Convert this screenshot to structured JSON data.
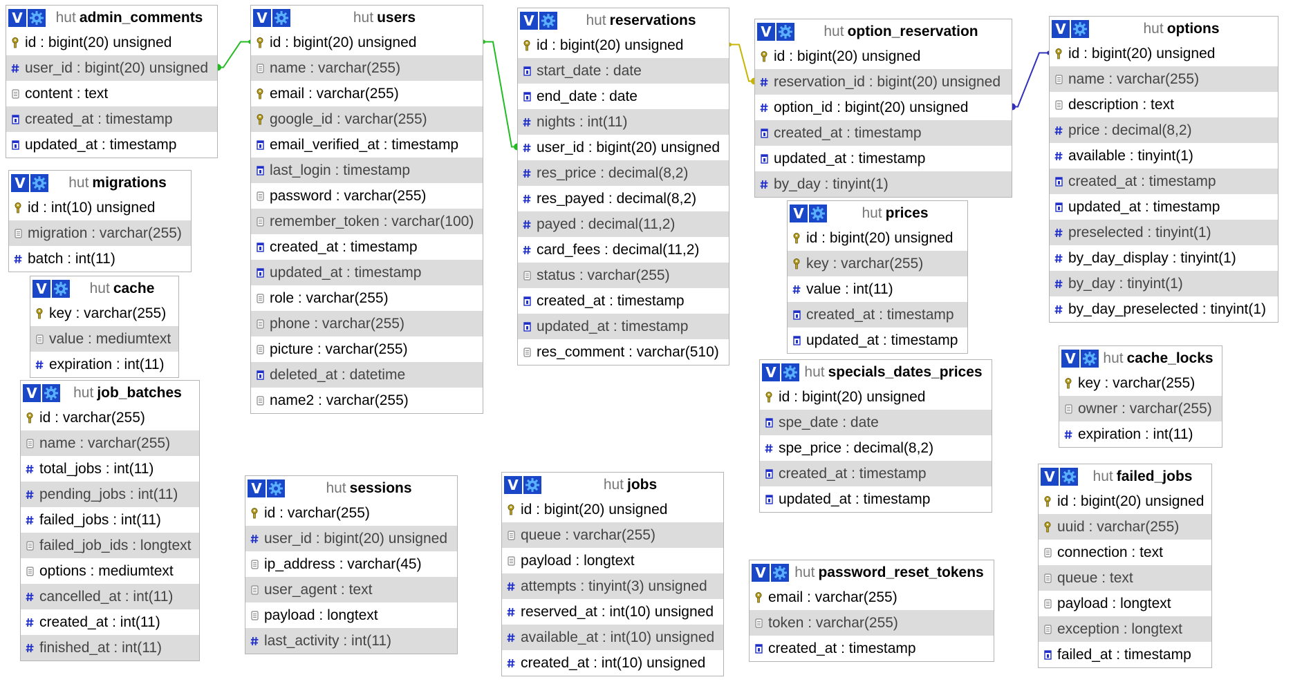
{
  "db_name": "hut",
  "header_button_label": "V",
  "colors": {
    "header_button": "#1a47c7",
    "row_alt": "#dcdcdc",
    "key_icon": "#b8a020",
    "hash_icon": "#2030c8",
    "link_green": "#22bb22",
    "link_yellow": "#c8b400",
    "link_blue": "#3030bb"
  },
  "tables": [
    {
      "name": "admin_comments",
      "columns": [
        {
          "text": "id : bigint(20) unsigned",
          "icon": "key-icon"
        },
        {
          "text": "user_id : bigint(20) unsigned",
          "icon": "hash-icon"
        },
        {
          "text": "content : text",
          "icon": "text-icon"
        },
        {
          "text": "created_at : timestamp",
          "icon": "time-icon"
        },
        {
          "text": "updated_at : timestamp",
          "icon": "time-icon"
        }
      ]
    },
    {
      "name": "migrations",
      "columns": [
        {
          "text": "id : int(10) unsigned",
          "icon": "key-icon"
        },
        {
          "text": "migration : varchar(255)",
          "icon": "text-icon"
        },
        {
          "text": "batch : int(11)",
          "icon": "hash-icon"
        }
      ]
    },
    {
      "name": "cache",
      "columns": [
        {
          "text": "key : varchar(255)",
          "icon": "key-icon"
        },
        {
          "text": "value : mediumtext",
          "icon": "text-icon"
        },
        {
          "text": "expiration : int(11)",
          "icon": "hash-icon"
        }
      ]
    },
    {
      "name": "job_batches",
      "columns": [
        {
          "text": "id : varchar(255)",
          "icon": "key-icon"
        },
        {
          "text": "name : varchar(255)",
          "icon": "text-icon"
        },
        {
          "text": "total_jobs : int(11)",
          "icon": "hash-icon"
        },
        {
          "text": "pending_jobs : int(11)",
          "icon": "hash-icon"
        },
        {
          "text": "failed_jobs : int(11)",
          "icon": "hash-icon"
        },
        {
          "text": "failed_job_ids : longtext",
          "icon": "text-icon"
        },
        {
          "text": "options : mediumtext",
          "icon": "text-icon"
        },
        {
          "text": "cancelled_at : int(11)",
          "icon": "hash-icon"
        },
        {
          "text": "created_at : int(11)",
          "icon": "hash-icon"
        },
        {
          "text": "finished_at : int(11)",
          "icon": "hash-icon"
        }
      ]
    },
    {
      "name": "users",
      "columns": [
        {
          "text": "id : bigint(20) unsigned",
          "icon": "key-icon"
        },
        {
          "text": "name : varchar(255)",
          "icon": "text-icon"
        },
        {
          "text": "email : varchar(255)",
          "icon": "key-icon"
        },
        {
          "text": "google_id : varchar(255)",
          "icon": "key-icon"
        },
        {
          "text": "email_verified_at : timestamp",
          "icon": "time-icon"
        },
        {
          "text": "last_login : timestamp",
          "icon": "time-icon"
        },
        {
          "text": "password : varchar(255)",
          "icon": "text-icon"
        },
        {
          "text": "remember_token : varchar(100)",
          "icon": "text-icon"
        },
        {
          "text": "created_at : timestamp",
          "icon": "time-icon"
        },
        {
          "text": "updated_at : timestamp",
          "icon": "time-icon"
        },
        {
          "text": "role : varchar(255)",
          "icon": "text-icon"
        },
        {
          "text": "phone : varchar(255)",
          "icon": "text-icon"
        },
        {
          "text": "picture : varchar(255)",
          "icon": "text-icon"
        },
        {
          "text": "deleted_at : datetime",
          "icon": "time-icon"
        },
        {
          "text": "name2 : varchar(255)",
          "icon": "text-icon"
        }
      ]
    },
    {
      "name": "sessions",
      "columns": [
        {
          "text": "id : varchar(255)",
          "icon": "key-icon"
        },
        {
          "text": "user_id : bigint(20) unsigned",
          "icon": "hash-icon"
        },
        {
          "text": "ip_address : varchar(45)",
          "icon": "text-icon"
        },
        {
          "text": "user_agent : text",
          "icon": "text-icon"
        },
        {
          "text": "payload : longtext",
          "icon": "text-icon"
        },
        {
          "text": "last_activity : int(11)",
          "icon": "hash-icon"
        }
      ]
    },
    {
      "name": "reservations",
      "columns": [
        {
          "text": "id : bigint(20) unsigned",
          "icon": "key-icon"
        },
        {
          "text": "start_date : date",
          "icon": "time-icon"
        },
        {
          "text": "end_date : date",
          "icon": "time-icon"
        },
        {
          "text": "nights : int(11)",
          "icon": "hash-icon"
        },
        {
          "text": "user_id : bigint(20) unsigned",
          "icon": "hash-icon"
        },
        {
          "text": "res_price : decimal(8,2)",
          "icon": "hash-icon"
        },
        {
          "text": "res_payed : decimal(8,2)",
          "icon": "hash-icon"
        },
        {
          "text": "payed : decimal(11,2)",
          "icon": "hash-icon"
        },
        {
          "text": "card_fees : decimal(11,2)",
          "icon": "hash-icon"
        },
        {
          "text": "status : varchar(255)",
          "icon": "text-icon"
        },
        {
          "text": "created_at : timestamp",
          "icon": "time-icon"
        },
        {
          "text": "updated_at : timestamp",
          "icon": "time-icon"
        },
        {
          "text": "res_comment : varchar(510)",
          "icon": "text-icon"
        }
      ]
    },
    {
      "name": "jobs",
      "columns": [
        {
          "text": "id : bigint(20) unsigned",
          "icon": "key-icon"
        },
        {
          "text": "queue : varchar(255)",
          "icon": "text-icon"
        },
        {
          "text": "payload : longtext",
          "icon": "text-icon"
        },
        {
          "text": "attempts : tinyint(3) unsigned",
          "icon": "hash-icon"
        },
        {
          "text": "reserved_at : int(10) unsigned",
          "icon": "hash-icon"
        },
        {
          "text": "available_at : int(10) unsigned",
          "icon": "hash-icon"
        },
        {
          "text": "created_at : int(10) unsigned",
          "icon": "hash-icon"
        }
      ]
    },
    {
      "name": "option_reservation",
      "columns": [
        {
          "text": "id : bigint(20) unsigned",
          "icon": "key-icon"
        },
        {
          "text": "reservation_id : bigint(20) unsigned",
          "icon": "hash-icon"
        },
        {
          "text": "option_id : bigint(20) unsigned",
          "icon": "hash-icon"
        },
        {
          "text": "created_at : timestamp",
          "icon": "time-icon"
        },
        {
          "text": "updated_at : timestamp",
          "icon": "time-icon"
        },
        {
          "text": "by_day : tinyint(1)",
          "icon": "hash-icon"
        }
      ]
    },
    {
      "name": "prices",
      "columns": [
        {
          "text": "id : bigint(20) unsigned",
          "icon": "key-icon"
        },
        {
          "text": "key : varchar(255)",
          "icon": "key-icon"
        },
        {
          "text": "value : int(11)",
          "icon": "hash-icon"
        },
        {
          "text": "created_at : timestamp",
          "icon": "time-icon"
        },
        {
          "text": "updated_at : timestamp",
          "icon": "time-icon"
        }
      ]
    },
    {
      "name": "specials_dates_prices",
      "columns": [
        {
          "text": "id : bigint(20) unsigned",
          "icon": "key-icon"
        },
        {
          "text": "spe_date : date",
          "icon": "time-icon"
        },
        {
          "text": "spe_price : decimal(8,2)",
          "icon": "hash-icon"
        },
        {
          "text": "created_at : timestamp",
          "icon": "time-icon"
        },
        {
          "text": "updated_at : timestamp",
          "icon": "time-icon"
        }
      ]
    },
    {
      "name": "password_reset_tokens",
      "columns": [
        {
          "text": "email : varchar(255)",
          "icon": "key-icon"
        },
        {
          "text": "token : varchar(255)",
          "icon": "text-icon"
        },
        {
          "text": "created_at : timestamp",
          "icon": "time-icon"
        }
      ]
    },
    {
      "name": "options",
      "columns": [
        {
          "text": "id : bigint(20) unsigned",
          "icon": "key-icon"
        },
        {
          "text": "name : varchar(255)",
          "icon": "text-icon"
        },
        {
          "text": "description : text",
          "icon": "text-icon"
        },
        {
          "text": "price : decimal(8,2)",
          "icon": "hash-icon"
        },
        {
          "text": "available : tinyint(1)",
          "icon": "hash-icon"
        },
        {
          "text": "created_at : timestamp",
          "icon": "time-icon"
        },
        {
          "text": "updated_at : timestamp",
          "icon": "time-icon"
        },
        {
          "text": "preselected : tinyint(1)",
          "icon": "hash-icon"
        },
        {
          "text": "by_day_display : tinyint(1)",
          "icon": "hash-icon"
        },
        {
          "text": "by_day : tinyint(1)",
          "icon": "hash-icon"
        },
        {
          "text": "by_day_preselected : tinyint(1)",
          "icon": "hash-icon"
        }
      ]
    },
    {
      "name": "cache_locks",
      "columns": [
        {
          "text": "key : varchar(255)",
          "icon": "key-icon"
        },
        {
          "text": "owner : varchar(255)",
          "icon": "text-icon"
        },
        {
          "text": "expiration : int(11)",
          "icon": "hash-icon"
        }
      ]
    },
    {
      "name": "failed_jobs",
      "columns": [
        {
          "text": "id : bigint(20) unsigned",
          "icon": "key-icon"
        },
        {
          "text": "uuid : varchar(255)",
          "icon": "key-icon"
        },
        {
          "text": "connection : text",
          "icon": "text-icon"
        },
        {
          "text": "queue : text",
          "icon": "text-icon"
        },
        {
          "text": "payload : longtext",
          "icon": "text-icon"
        },
        {
          "text": "exception : longtext",
          "icon": "text-icon"
        },
        {
          "text": "failed_at : timestamp",
          "icon": "time-icon"
        }
      ]
    }
  ],
  "relations": [
    {
      "from": "admin_comments.user_id",
      "to": "users.id",
      "color": "#22bb22"
    },
    {
      "from": "reservations.user_id",
      "to": "users.id",
      "color": "#22bb22"
    },
    {
      "from": "option_reservation.reservation_id",
      "to": "reservations.id",
      "color": "#c8b400"
    },
    {
      "from": "option_reservation.option_id",
      "to": "options.id",
      "color": "#3030bb"
    }
  ]
}
